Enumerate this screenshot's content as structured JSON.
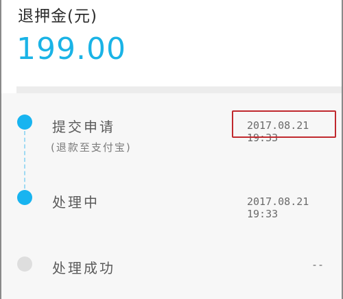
{
  "header": {
    "label": "退押金(元)",
    "amount": "199.00"
  },
  "steps": [
    {
      "title": "提交申请",
      "note": "(退款至支付宝)",
      "time": "2017.08.21 19:33",
      "status": "completed"
    },
    {
      "title": "处理中",
      "time": "2017.08.21 19:33",
      "status": "completed"
    },
    {
      "title": "处理成功",
      "time": "--",
      "status": "pending"
    }
  ],
  "colors": {
    "accent": "#18b4f0",
    "amount": "#1ab3e6",
    "highlight": "#c0282d",
    "pending_dot": "#dedede"
  }
}
